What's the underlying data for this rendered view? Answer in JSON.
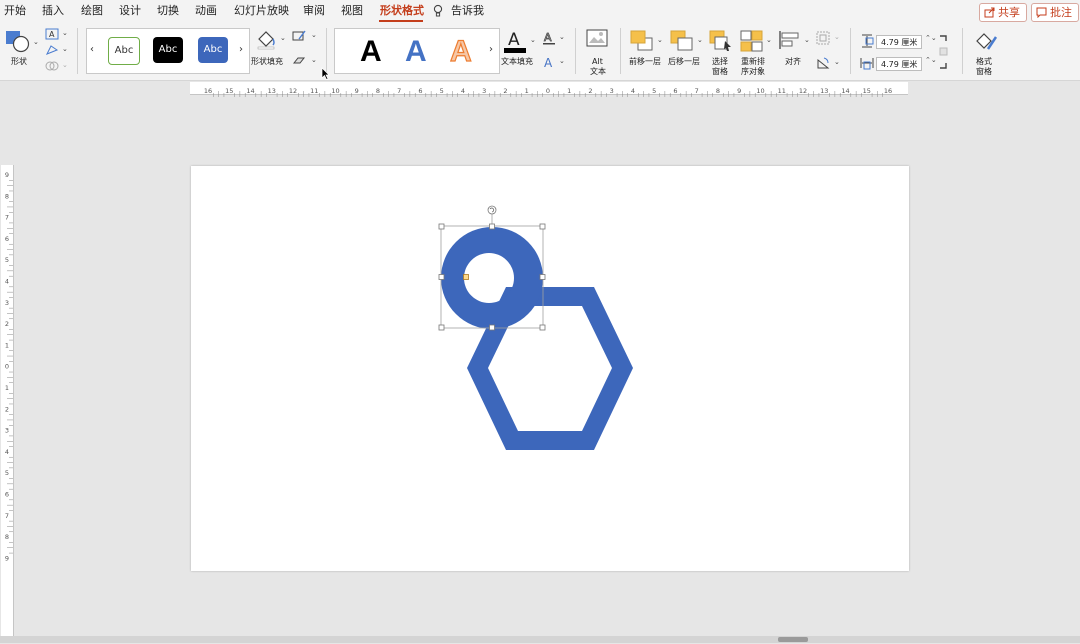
{
  "menu": {
    "tabs": [
      "开始",
      "插入",
      "绘图",
      "设计",
      "切换",
      "动画",
      "幻灯片放映",
      "审阅",
      "视图",
      "形状格式",
      "告诉我"
    ],
    "active_tab": "形状格式",
    "share_label": "共享",
    "comment_label": "批注"
  },
  "ribbon": {
    "shapes_label": "形状",
    "style_samples": [
      "Abc",
      "Abc",
      "Abc"
    ],
    "shape_fill_label": "形状填充",
    "wordart_letters": [
      "A",
      "A",
      "A"
    ],
    "text_fill_label": "文本填充",
    "alt_text_label_1": "Alt",
    "alt_text_label_2": "文本",
    "bring_forward_label": "前移一层",
    "send_backward_label": "后移一层",
    "selection_pane_label_1": "选择",
    "selection_pane_label_2": "窗格",
    "reorder_label_1": "重新排",
    "reorder_label_2": "序对象",
    "align_label": "对齐",
    "height_value": "4.79 厘米",
    "width_value": "4.79 厘米",
    "format_pane_label_1": "格式",
    "format_pane_label_2": "窗格"
  },
  "ruler": {
    "h_labels": [
      "16",
      "15",
      "14",
      "13",
      "12",
      "11",
      "10",
      "9",
      "8",
      "7",
      "6",
      "5",
      "4",
      "3",
      "2",
      "1",
      "0",
      "1",
      "2",
      "3",
      "4",
      "5",
      "6",
      "7",
      "8",
      "9",
      "10",
      "11",
      "12",
      "13",
      "14",
      "15",
      "16"
    ],
    "v_labels": [
      "9",
      "8",
      "7",
      "6",
      "5",
      "4",
      "3",
      "2",
      "1",
      "0",
      "1",
      "2",
      "3",
      "4",
      "5",
      "6",
      "7",
      "8",
      "9"
    ]
  },
  "colors": {
    "accent": "#c43e1c",
    "shape_blue": "#3d67bb",
    "style_green": "#70ad47",
    "wordart_blue": "#4472c4",
    "wordart_orange": "#ed7d31",
    "ribbon_bg": "#f3f3f3",
    "workspace_bg": "#e6e6e6"
  },
  "icons": {
    "share": "share-icon",
    "comment": "comment-icon",
    "tell_me": "lightbulb-icon",
    "rotate_handle": "rotate-handle-icon"
  }
}
